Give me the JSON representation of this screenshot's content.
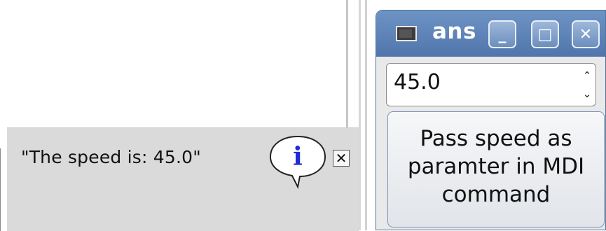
{
  "status_bar": {
    "message": "\"The speed is:  45.0\"",
    "info_icon_glyph": "i",
    "close_glyph": "✕"
  },
  "window": {
    "title": "ans",
    "minimize_glyph": "_",
    "maximize_glyph": "□",
    "close_glyph": "✕",
    "spinbox_value": "45.0",
    "spin_up_glyph": "⌃",
    "spin_down_glyph": "⌄",
    "button_label": "Pass speed as\nparamter in MDI\ncommand"
  },
  "colors": {
    "titlebar": "#5a80b5",
    "info_blue": "#1f2bd6"
  }
}
